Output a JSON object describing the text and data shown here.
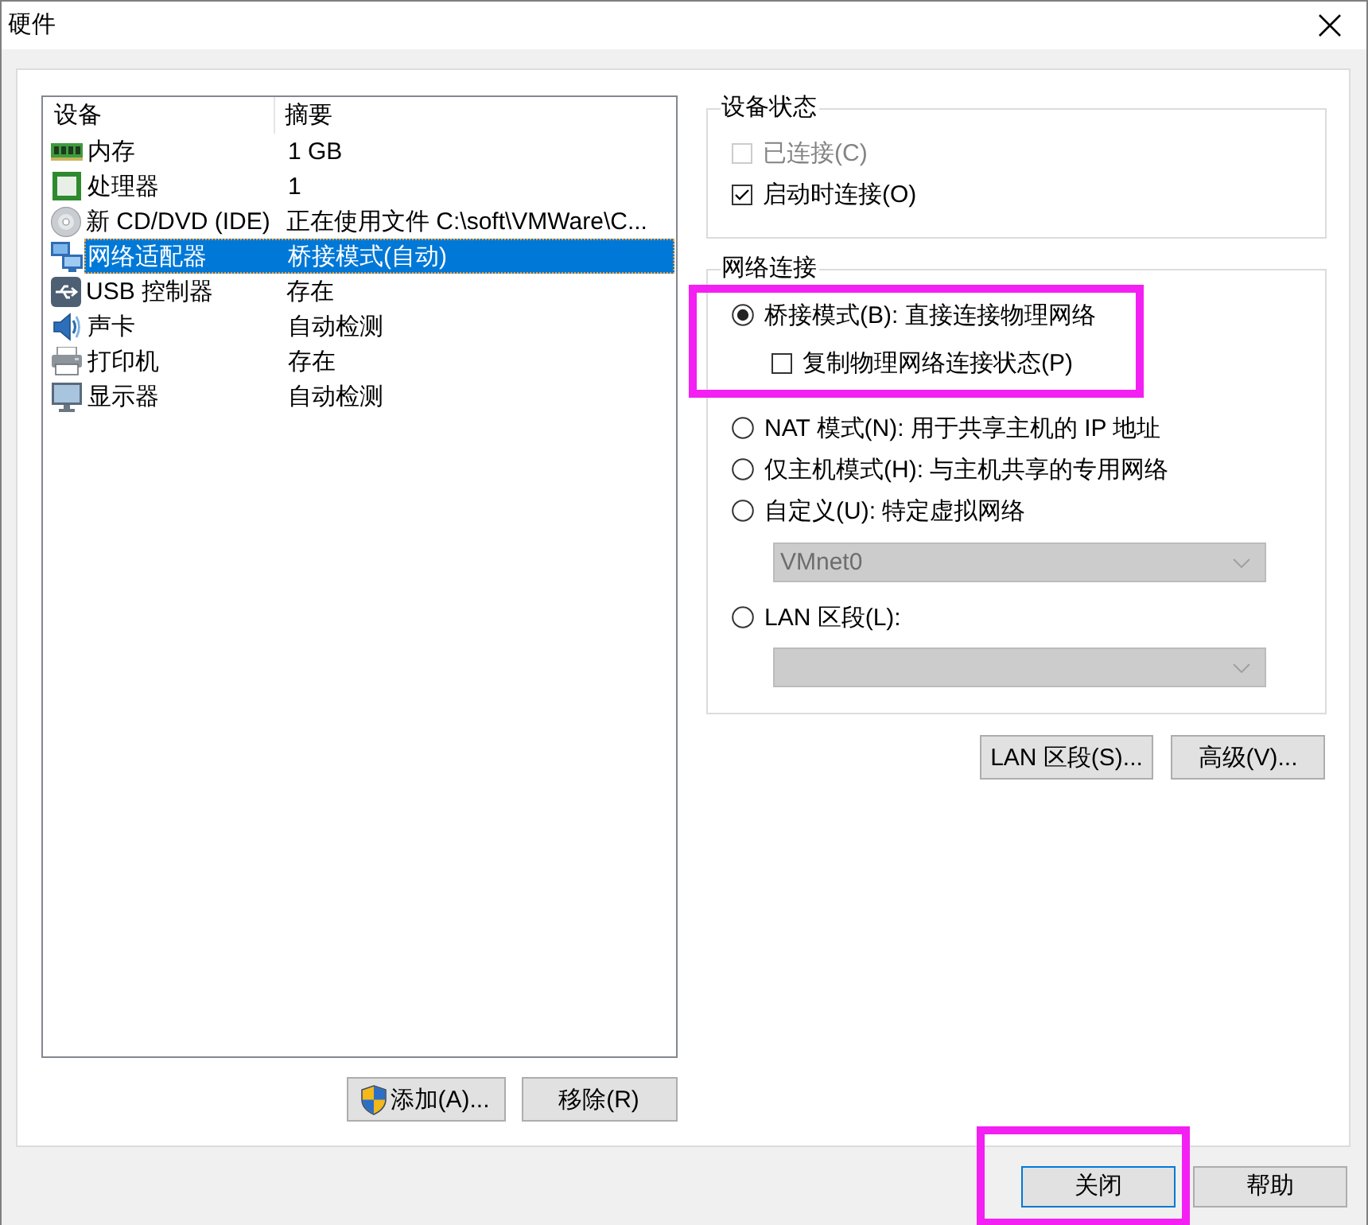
{
  "window": {
    "title": "硬件"
  },
  "device_list": {
    "columns": [
      "设备",
      "摘要"
    ],
    "rows": [
      {
        "device": "内存",
        "summary": "1 GB",
        "kind": "memory",
        "selected": false
      },
      {
        "device": "处理器",
        "summary": "1",
        "kind": "processor",
        "selected": false
      },
      {
        "device": "新 CD/DVD (IDE)",
        "summary": "正在使用文件 C:\\soft\\VMWare\\C...",
        "kind": "cdrom",
        "selected": false
      },
      {
        "device": "网络适配器",
        "summary": "桥接模式(自动)",
        "kind": "network",
        "selected": true
      },
      {
        "device": "USB 控制器",
        "summary": "存在",
        "kind": "usb",
        "selected": false
      },
      {
        "device": "声卡",
        "summary": "自动检测",
        "kind": "sound",
        "selected": false
      },
      {
        "device": "打印机",
        "summary": "存在",
        "kind": "printer",
        "selected": false
      },
      {
        "device": "显示器",
        "summary": "自动检测",
        "kind": "display",
        "selected": false
      }
    ]
  },
  "list_buttons": [
    {
      "label": "添加(A)...",
      "kind": "admin"
    },
    {
      "label": "移除(R)",
      "kind": "plain"
    }
  ],
  "device_status": {
    "legend": "设备状态",
    "options": [
      {
        "label": "已连接(C)",
        "checked": false,
        "disabled": true
      },
      {
        "label": "启动时连接(O)",
        "checked": true,
        "disabled": false
      }
    ]
  },
  "network_connection": {
    "legend": "网络连接",
    "options": [
      {
        "label": "桥接模式(B): 直接连接物理网络",
        "selected": true,
        "highlighted": true,
        "sub_option": {
          "label": "复制物理网络连接状态(P)",
          "checked": false
        }
      },
      {
        "label": "NAT 模式(N): 用于共享主机的 IP 地址",
        "selected": false,
        "highlighted": false
      },
      {
        "label": "仅主机模式(H): 与主机共享的专用网络",
        "selected": false,
        "highlighted": false
      },
      {
        "label": "自定义(U): 特定虚拟网络",
        "selected": false,
        "highlighted": false,
        "dropdown": {
          "value": "VMnet0",
          "disabled": true
        }
      },
      {
        "label": "LAN 区段(L):",
        "selected": false,
        "highlighted": false,
        "dropdown": {
          "disabled": true
        }
      }
    ],
    "buttons": [
      "LAN 区段(S)...",
      "高级(V)..."
    ]
  },
  "dialog_buttons": [
    {
      "label": "关闭",
      "default": true,
      "highlighted": true
    },
    {
      "label": "帮助",
      "default": false,
      "highlighted": false
    }
  ]
}
